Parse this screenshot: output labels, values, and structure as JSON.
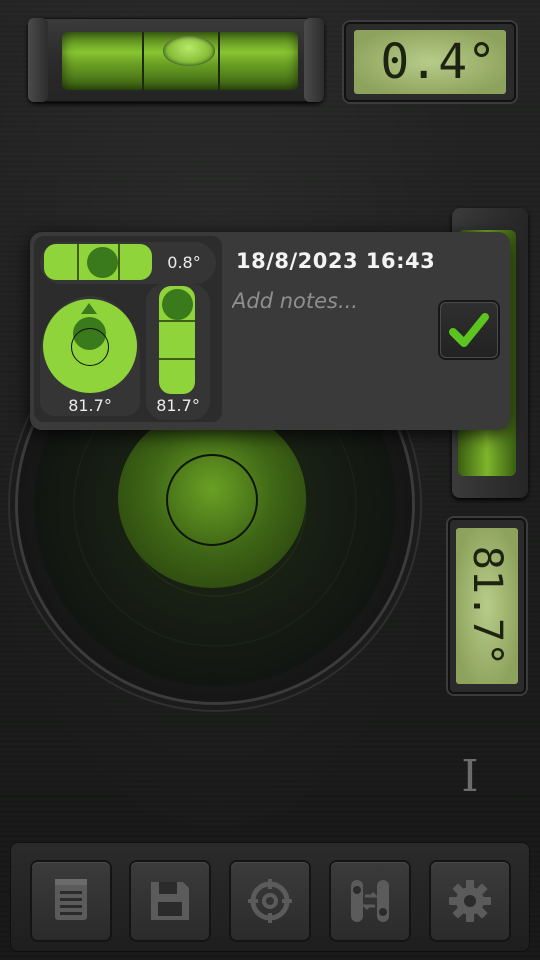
{
  "readouts": {
    "horizontal_lcd": "0.4°",
    "vertical_lcd": "81.7°"
  },
  "popup": {
    "horizontal_angle": "0.8°",
    "circle_angle": "81.7°",
    "vertical_angle": "81.7°",
    "datetime": "18/8/2023 16:43",
    "notes_placeholder": "Add notes...",
    "notes_value": "",
    "confirm_checked": true
  },
  "cursor_mark": "I",
  "toolbar": {
    "buttons": [
      {
        "icon": "notes-list-icon"
      },
      {
        "icon": "save-floppy-icon"
      },
      {
        "icon": "calibrate-target-icon"
      },
      {
        "icon": "swap-levels-icon"
      },
      {
        "icon": "gear-icon"
      }
    ]
  },
  "colors": {
    "accent_green": "#8fd43a",
    "bubble_dark_green": "#3b7a1c",
    "check_green": "#5bc41e",
    "lcd_bg": "#9fb570"
  }
}
